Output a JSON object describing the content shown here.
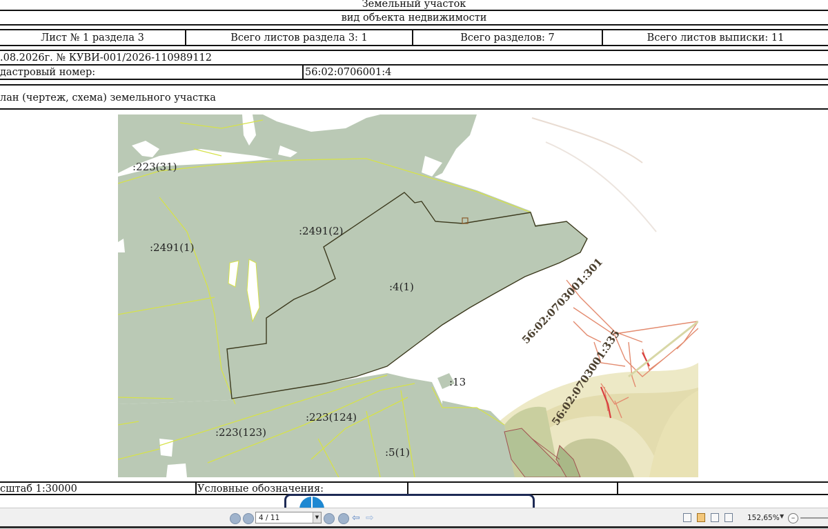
{
  "header": {
    "title": "Земельный участок",
    "subtitle": "вид объекта недвижимости"
  },
  "sheet_info": {
    "sheet": "Лист № 1 раздела 3",
    "section_sheets": "Всего листов раздела 3: 1",
    "total_sections": "Всего разделов: 7",
    "total_sheets": "Всего листов выписки: 11"
  },
  "statement": {
    "date_number": ".08.2026г. № КУВИ-001/2026-110989112"
  },
  "cadastral": {
    "label": "дастровый номер:",
    "value": "56:02:0706001:4"
  },
  "plan": {
    "title": "лан (чертеж, схема) земельного участка"
  },
  "map": {
    "parcel_labels": [
      ":223(31)",
      ":2491(2)",
      ":2491(1)",
      ":4(1)",
      ":13",
      ":223(124)",
      ":223(123)",
      ":5(1)"
    ],
    "cadastral_block_labels": [
      "56:02:0703001:301",
      "56:02:0703001:335"
    ],
    "colors": {
      "parcel_fill": "#bac9b5",
      "parcel_border": "#d6e24a",
      "target_border": "#3c3a1e",
      "road": "#e38b6f",
      "river_band": "#e6e1b4"
    }
  },
  "footer": {
    "scale": "сштаб 1:30000",
    "legend": "Условные обозначения:"
  },
  "toolbar": {
    "page_value": "4 / 11",
    "zoom": "152,65%",
    "icons": [
      "zoom-out-page-icon",
      "page-up-icon",
      "page-down-icon",
      "zoom-in-page-icon",
      "back-icon",
      "forward-icon"
    ]
  }
}
